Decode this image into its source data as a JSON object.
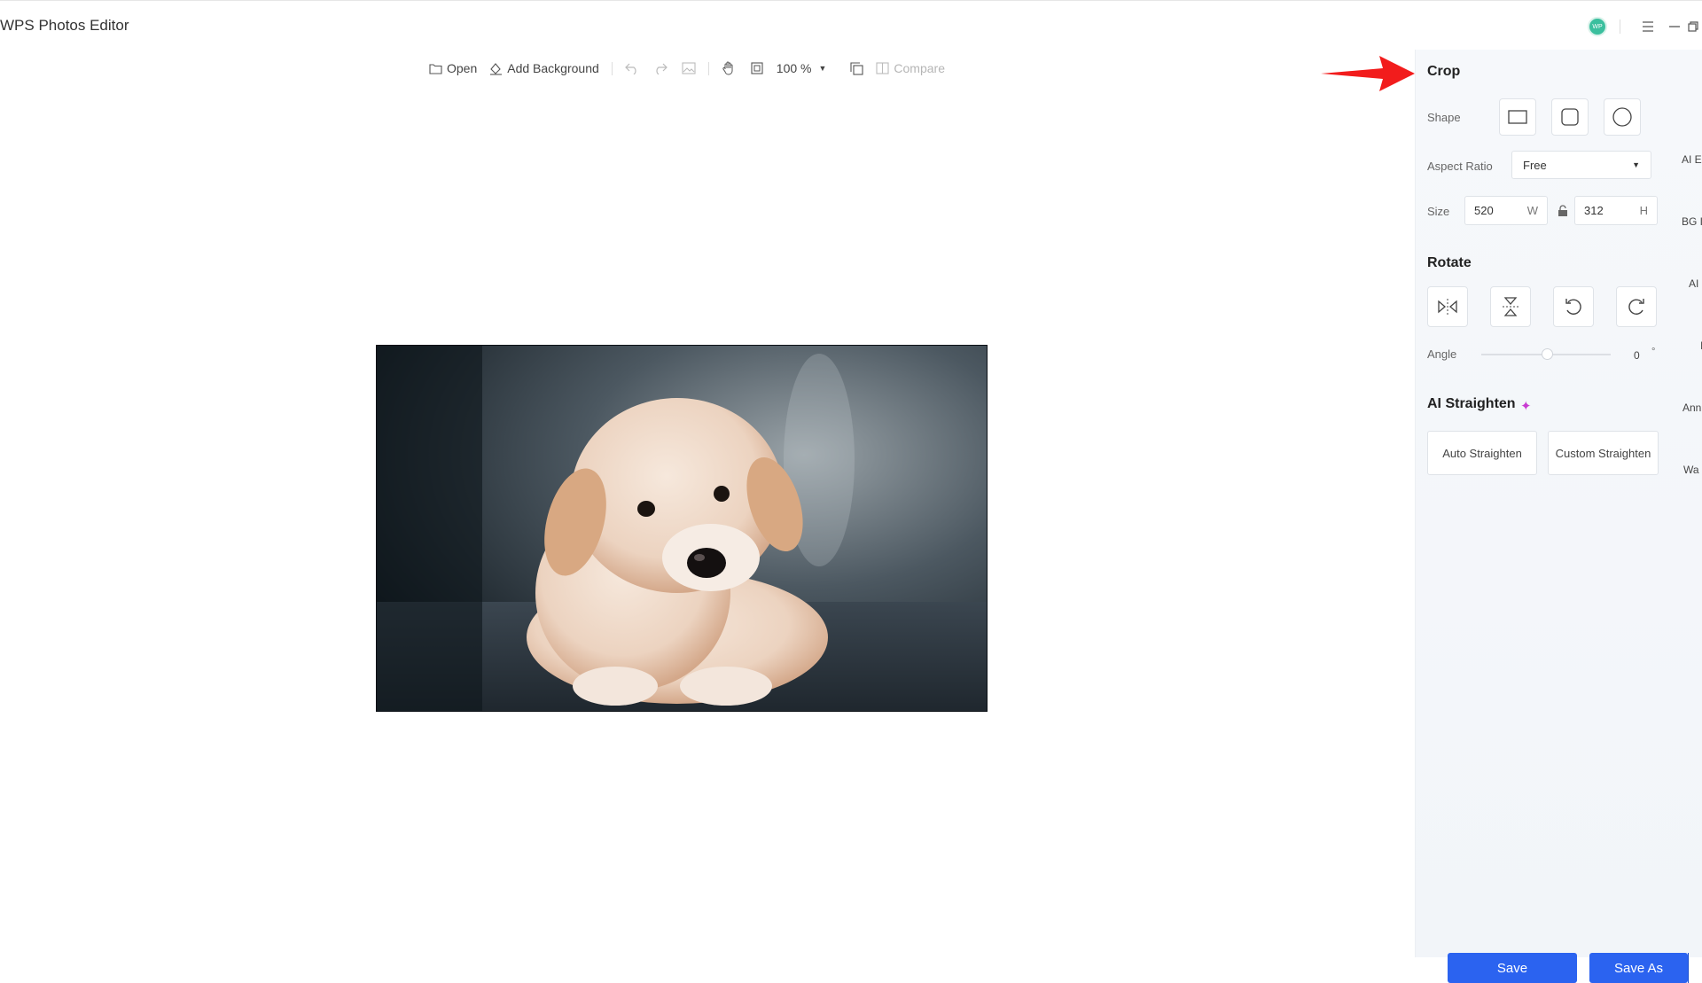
{
  "app": {
    "title": "WPS Photos Editor",
    "avatar_initials": "WP",
    "accent_color": "#2b63f0",
    "avatar_color": "#3bbf9e"
  },
  "toolbar": {
    "open_label": "Open",
    "add_background_label": "Add Background",
    "zoom_value": "100 %",
    "compare_label": "Compare"
  },
  "panel": {
    "crop": {
      "title": "Crop",
      "shape_label": "Shape",
      "aspect_ratio_label": "Aspect Ratio",
      "aspect_ratio_value": "Free",
      "size_label": "Size",
      "width_value": "520",
      "width_unit": "W",
      "height_value": "312",
      "height_unit": "H"
    },
    "rotate": {
      "title": "Rotate",
      "angle_label": "Angle",
      "angle_value": "0",
      "angle_unit": "°"
    },
    "straighten": {
      "title": "AI Straighten",
      "auto_label": "Auto Straighten",
      "custom_label": "Custom Straighten"
    },
    "save_label": "Save",
    "save_as_label": "Save As"
  },
  "side_rail": {
    "items": [
      "AI E",
      "BG I",
      "AI",
      "I",
      "Ann",
      "Wa"
    ]
  }
}
